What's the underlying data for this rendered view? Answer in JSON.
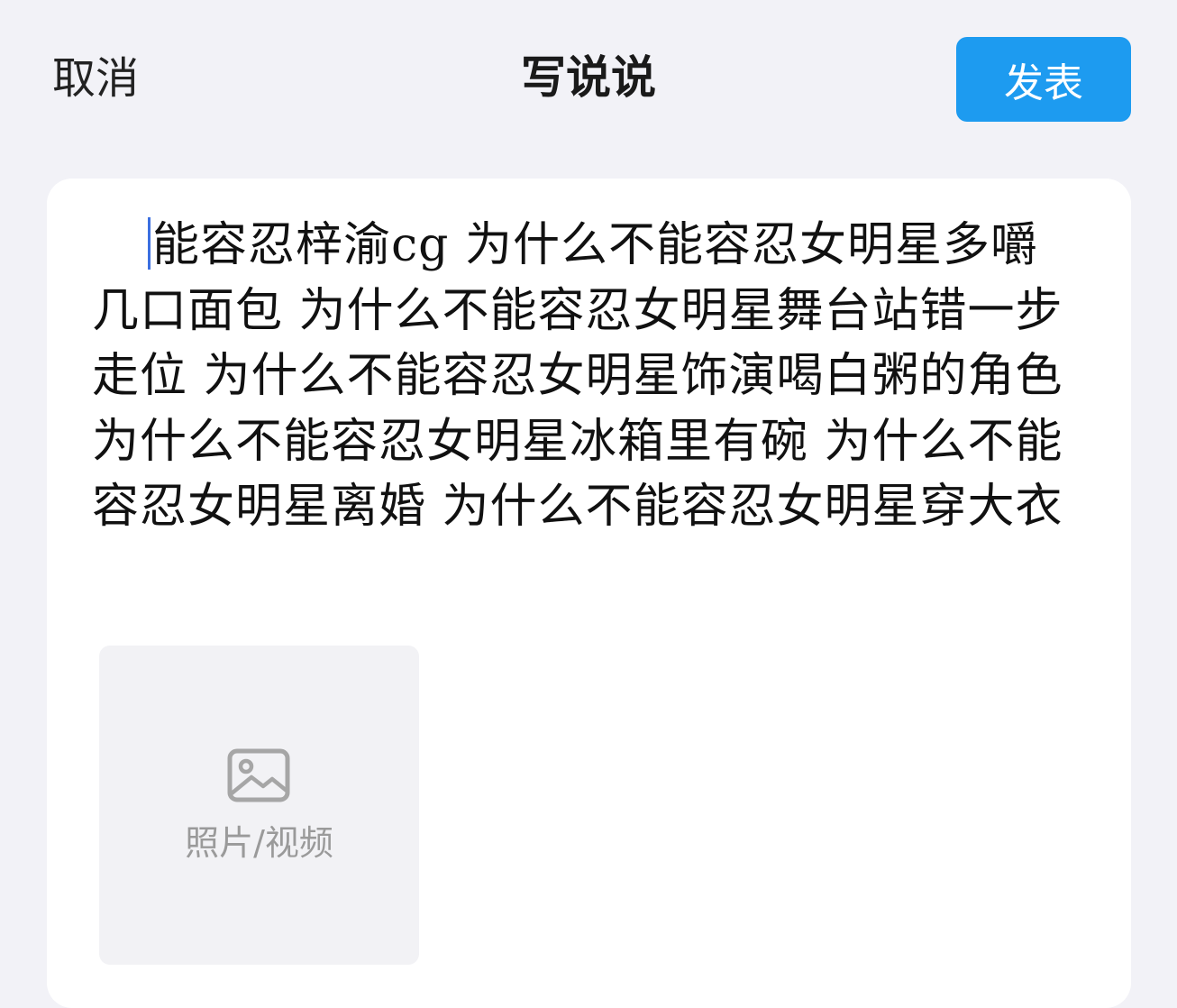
{
  "header": {
    "cancel_label": "取消",
    "title": "写说说",
    "publish_label": "发表"
  },
  "composer": {
    "text": "能容忍梓渝cg 为什么不能容忍女明星多嚼几口面包  为什么不能容忍女明星舞台站错一步走位 为什么不能容忍女明星饰演喝白粥的角色 为什么不能容忍女明星冰箱里有碗 为什么不能容忍女明星离婚 为什么不能容忍女明星穿大衣"
  },
  "media": {
    "icon": "image-icon",
    "label": "照片/视频"
  },
  "colors": {
    "accent": "#1d9bf0",
    "background": "#f2f2f7",
    "card": "#ffffff",
    "caret": "#3b6fe0"
  }
}
